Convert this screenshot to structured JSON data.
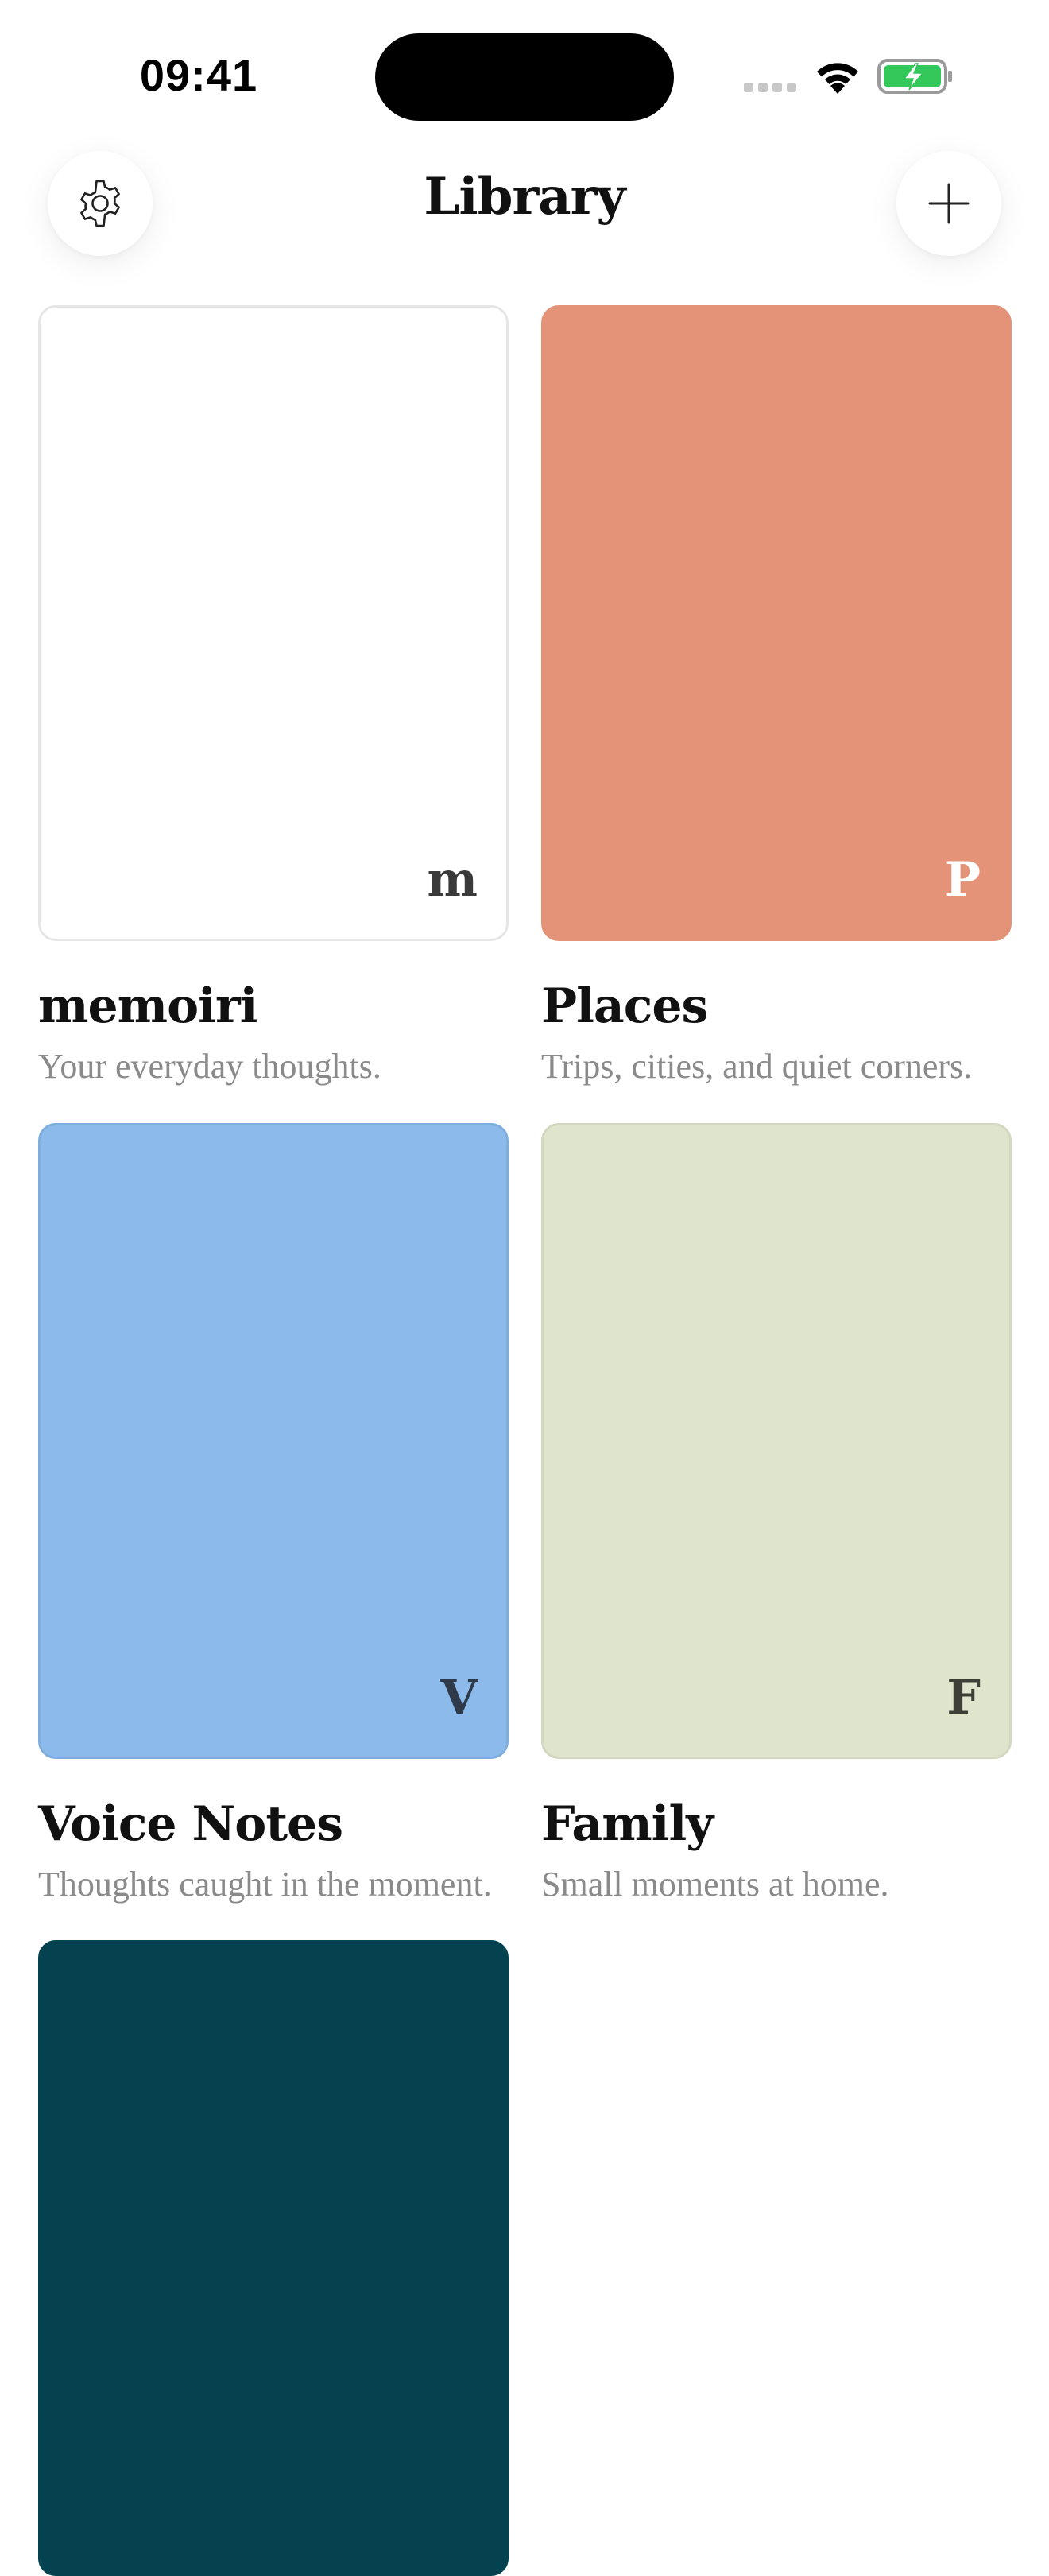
{
  "status_bar": {
    "time": "09:41",
    "battery_color": "#34C759"
  },
  "header": {
    "title": "Library",
    "settings_icon": "gear-icon",
    "add_icon": "plus-icon"
  },
  "journals": [
    {
      "title": "memoiri",
      "subtitle": "Your everyday thoughts.",
      "letter": "m",
      "color": "#FFFFFF",
      "border": "#E6E6E6",
      "letter_color": "#3A3A3A"
    },
    {
      "title": "Places",
      "subtitle": "Trips, cities, and quiet corners.",
      "letter": "P",
      "color": "#E49378",
      "border": "#E49378",
      "letter_color": "#FFFFFF"
    },
    {
      "title": "Voice Notes",
      "subtitle": "Thoughts caught in the moment.",
      "letter": "V",
      "color": "#8CBBEB",
      "border": "#7FAEDD",
      "letter_color": "#2E3A4A"
    },
    {
      "title": "Family",
      "subtitle": "Small moments at home.",
      "letter": "F",
      "color": "#DFE4CD",
      "border": "#D3D8C0",
      "letter_color": "#3E3F36"
    },
    {
      "title": "",
      "subtitle": "",
      "letter": "",
      "color": "#03424E",
      "border": "#03424E",
      "letter_color": "#FFFFFF"
    }
  ]
}
